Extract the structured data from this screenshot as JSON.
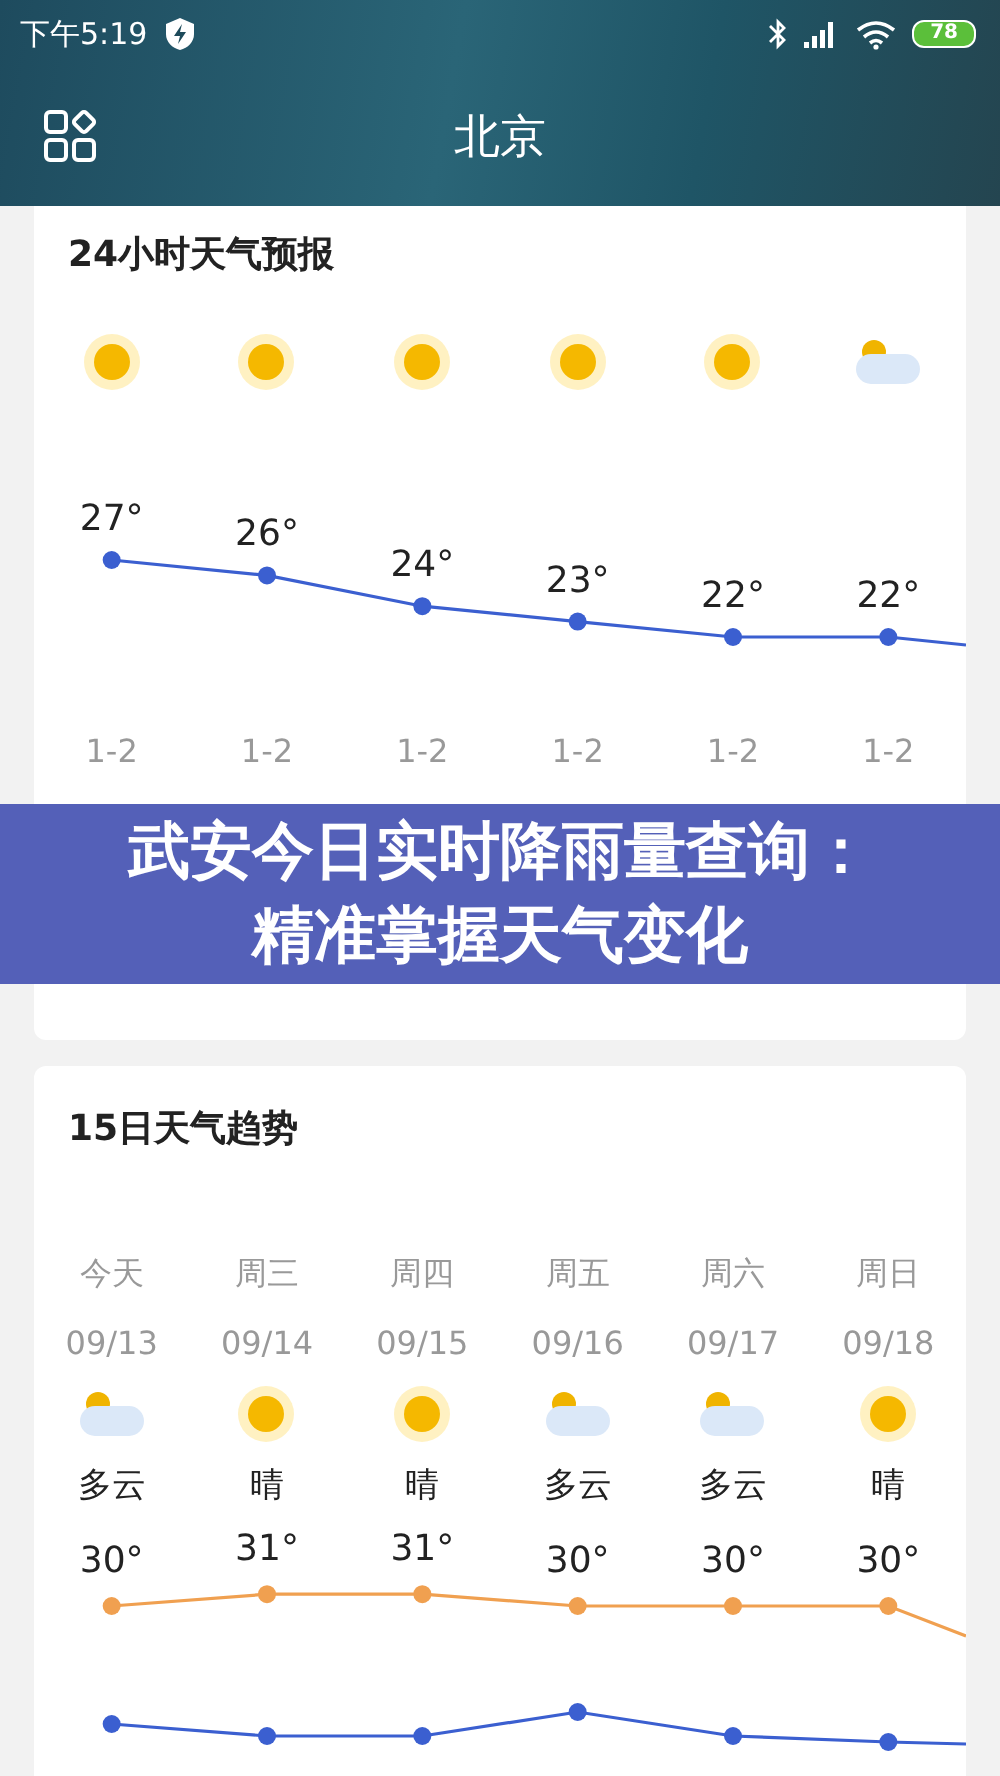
{
  "status_bar": {
    "time": "下午5:19",
    "battery": "78"
  },
  "header": {
    "title": "北京"
  },
  "hourly": {
    "title": "24小时天气预报",
    "items": [
      {
        "kind": "sun",
        "temp": "27°",
        "aqi": "1-2"
      },
      {
        "kind": "sun",
        "temp": "26°",
        "aqi": "1-2"
      },
      {
        "kind": "sun",
        "temp": "24°",
        "aqi": "1-2"
      },
      {
        "kind": "sun",
        "temp": "23°",
        "aqi": "1-2"
      },
      {
        "kind": "sun",
        "temp": "22°",
        "aqi": "1-2"
      },
      {
        "kind": "cloud",
        "temp": "22°",
        "aqi": "1-2"
      }
    ]
  },
  "banner": {
    "text": "武安今日实时降雨量查询：精准掌握天气变化"
  },
  "daily": {
    "title": "15日天气趋势",
    "items": [
      {
        "kind": "cloud",
        "day": "今天",
        "date": "09/13",
        "condition": "多云",
        "high": "30°"
      },
      {
        "kind": "sun",
        "day": "周三",
        "date": "09/14",
        "condition": "晴",
        "high": "31°"
      },
      {
        "kind": "sun",
        "day": "周四",
        "date": "09/15",
        "condition": "晴",
        "high": "31°"
      },
      {
        "kind": "cloud",
        "day": "周五",
        "date": "09/16",
        "condition": "多云",
        "high": "30°"
      },
      {
        "kind": "cloud",
        "day": "周六",
        "date": "09/17",
        "condition": "多云",
        "high": "30°"
      },
      {
        "kind": "sun",
        "day": "周日",
        "date": "09/18",
        "condition": "晴",
        "high": "30°"
      }
    ]
  }
}
